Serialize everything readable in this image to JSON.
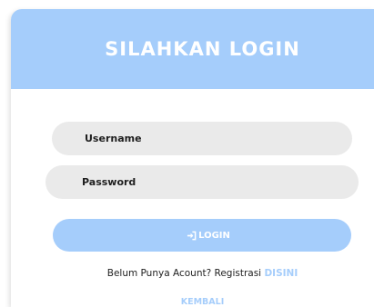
{
  "header": {
    "title": "SILAHKAN LOGIN"
  },
  "form": {
    "username_placeholder": "Username",
    "password_placeholder": "Password",
    "login_label": "LOGIN",
    "login_icon": "sign-in-icon"
  },
  "footer": {
    "register_prompt": "Belum Punya Acount? Registrasi",
    "register_link": "DISINI",
    "back_link": "KEMBALI"
  },
  "colors": {
    "accent": "#a5cdfb",
    "field_bg": "#eaeaea",
    "text": "#1e1e1e"
  }
}
